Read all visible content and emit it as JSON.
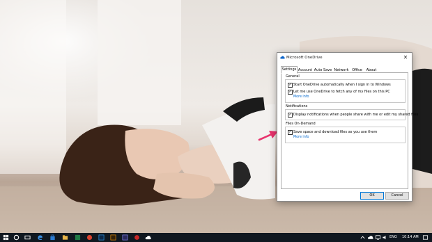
{
  "window": {
    "title": "Microsoft OneDrive",
    "close_glyph": "✕",
    "app_icon": "onedrive-cloud-icon"
  },
  "tabs": [
    {
      "label": "Settings",
      "active": true
    },
    {
      "label": "Account",
      "active": false
    },
    {
      "label": "Auto Save",
      "active": false
    },
    {
      "label": "Network",
      "active": false
    },
    {
      "label": "Office",
      "active": false
    },
    {
      "label": "About",
      "active": false
    }
  ],
  "sections": {
    "general": {
      "label": "General",
      "options": [
        {
          "label": "Start OneDrive automatically when I sign in to Windows",
          "checked": true
        },
        {
          "label": "Let me use OneDrive to fetch any of my files on this PC",
          "checked": true
        }
      ],
      "link": "More info"
    },
    "notifications": {
      "label": "Notifications",
      "options": [
        {
          "label": "Display notifications when people share with me or edit my shared files",
          "checked": true
        }
      ]
    },
    "files_on_demand": {
      "label": "Files On-Demand",
      "options": [
        {
          "label": "Save space and download files as you use them",
          "checked": true
        }
      ],
      "link": "More info"
    }
  },
  "buttons": {
    "ok": "OK",
    "cancel": "Cancel"
  },
  "colors": {
    "link": "#0066cc",
    "annotation_arrow": "#e8336d",
    "taskbar": "#101820"
  },
  "check_glyph": "✓",
  "taskbar": {
    "icons": [
      "start-icon",
      "cortana-icon",
      "task-view-icon",
      "edge-icon",
      "store-icon",
      "file-explorer-icon",
      "app-icon",
      "app-icon",
      "photoshop-icon",
      "illustrator-icon",
      "app-icon",
      "onedrive-icon"
    ],
    "language": "ENG",
    "time": "10:14 AM"
  }
}
